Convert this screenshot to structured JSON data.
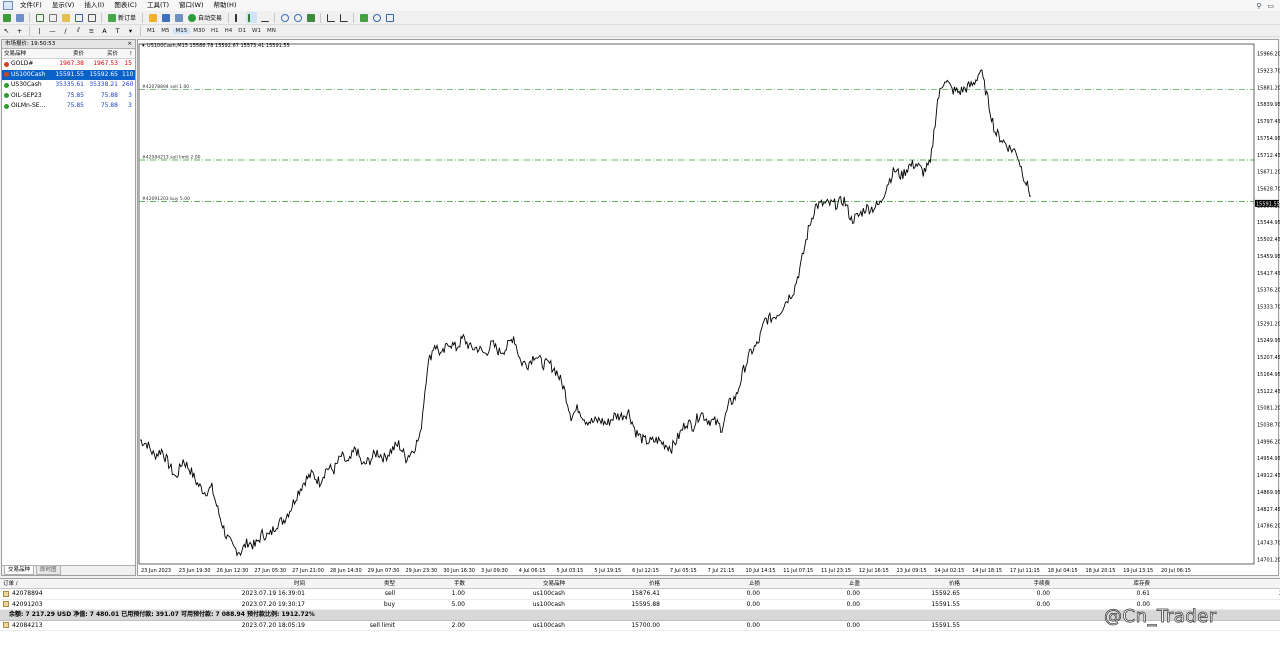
{
  "menu": [
    "文件(F)",
    "显示(V)",
    "插入(I)",
    "图表(C)",
    "工具(T)",
    "窗口(W)",
    "帮助(H)"
  ],
  "toolbar": {
    "new_order": "新订单",
    "auto_trading": "自动交易"
  },
  "timeframes": [
    "M1",
    "M5",
    "M15",
    "M30",
    "H1",
    "H4",
    "D1",
    "W1",
    "MN"
  ],
  "market": {
    "title": "市场报价: 19:50:53",
    "headers": [
      "交易品种",
      "卖价",
      "买价",
      "!"
    ],
    "rows": [
      {
        "symbol": "GOLD#",
        "bid": "1967.38",
        "ask": "1967.53",
        "spread": "15",
        "color": "#d84020",
        "pricecolor": "#e00000"
      },
      {
        "symbol": "US100Cash",
        "bid": "15591.55",
        "ask": "15592.65",
        "spread": "110",
        "color": "#d84020",
        "pricecolor": "#ffffff",
        "selected": true
      },
      {
        "symbol": "US30Cash",
        "bid": "35335.61",
        "ask": "35338.21",
        "spread": "260",
        "color": "#2aa02a",
        "pricecolor": "#1f3fd0"
      },
      {
        "symbol": "OIL-SEP23",
        "bid": "75.85",
        "ask": "75.88",
        "spread": "3",
        "color": "#2aa02a",
        "pricecolor": "#1f3fd0"
      },
      {
        "symbol": "OILMn-SE...",
        "bid": "75.85",
        "ask": "75.88",
        "spread": "3",
        "color": "#2aa02a",
        "pricecolor": "#1f3fd0"
      }
    ],
    "tabs": [
      "交易品种",
      "即时图"
    ]
  },
  "chart_data": {
    "type": "line",
    "title": "US100Cash,M15  15586.78 15592.67 15573.41 15591.55",
    "ylim": [
      14690,
      15990
    ],
    "y_ticks": [
      "15966.20",
      "15923.70",
      "15881.20",
      "15839.95",
      "15797.45",
      "15754.95",
      "15712.45",
      "15671.20",
      "15628.70",
      "15586.20",
      "15544.95",
      "15502.45",
      "15459.95",
      "15417.45",
      "15376.20",
      "15333.70",
      "15291.20",
      "15249.95",
      "15207.45",
      "15164.95",
      "15122.45",
      "15081.20",
      "15038.70",
      "14996.20",
      "14954.95",
      "14912.45",
      "14869.95",
      "14827.45",
      "14786.20",
      "14743.70",
      "14701.20",
      "14659.95"
    ],
    "x_ticks": [
      "23 Jun 2023",
      "23 Jun 19:30",
      "26 Jun 12:30",
      "27 Jun 05:30",
      "27 Jun 21:00",
      "28 Jun 14:30",
      "29 Jun 07:30",
      "29 Jun 23:30",
      "30 Jun 16:30",
      "3 Jul 09:30",
      "4 Jul 06:15",
      "5 Jul 03:15",
      "5 Jul 19:15",
      "6 Jul 12:15",
      "7 Jul 05:15",
      "7 Jul 21:15",
      "10 Jul 14:15",
      "11 Jul 07:15",
      "11 Jul 23:15",
      "12 Jul 16:15",
      "13 Jul 09:15",
      "14 Jul 02:15",
      "14 Jul 18:15",
      "17 Jul 11:15",
      "18 Jul 04:15",
      "18 Jul 20:15",
      "19 Jul 13:15",
      "20 Jul 06:15"
    ],
    "series": [
      {
        "values": [
          15000,
          14990,
          14960,
          14975,
          14940,
          14905,
          14950,
          14925,
          14890,
          14870,
          14880,
          14815,
          14760,
          14730,
          14720,
          14745,
          14735,
          14765,
          14760,
          14790,
          14800,
          14830,
          14870,
          14900,
          14915,
          14895,
          14930,
          14925,
          14960,
          14940,
          14980,
          14935,
          14950,
          14970,
          14955,
          14975,
          14990,
          14955,
          14975,
          15010,
          15185,
          15240,
          15210,
          15245,
          15230,
          15255,
          15230,
          15230,
          15215,
          15240,
          15220,
          15230,
          15260,
          15195,
          15190,
          15215,
          15190,
          15190,
          15170,
          15130,
          15060,
          15080,
          15050,
          15045,
          15050,
          15040,
          15060,
          15060,
          15070,
          15020,
          15000,
          14995,
          15000,
          14990,
          14980,
          15010,
          15045,
          15035,
          15070,
          15050,
          15045,
          15030,
          15090,
          15110,
          15175,
          15220,
          15240,
          15300,
          15305,
          15320,
          15350,
          15375,
          15440,
          15525,
          15585,
          15590,
          15590,
          15590,
          15600,
          15550,
          15560,
          15580,
          15580,
          15590,
          15640,
          15675,
          15660,
          15685,
          15690,
          15670,
          15690,
          15850,
          15905,
          15875,
          15870,
          15880,
          15890,
          15925,
          15850,
          15770,
          15750,
          15730,
          15720,
          15660,
          15610
        ]
      }
    ],
    "levels": [
      {
        "label": "#42078894 sell 1.00",
        "y": 15876.41
      },
      {
        "label": "#42084213 sell limit 2.00",
        "y": 15700.0
      },
      {
        "label": "#42091203 buy 5.00",
        "y": 15595.88
      }
    ],
    "current_price": "15591.55"
  },
  "terminal": {
    "headers": [
      "订单 /",
      "时间",
      "类型",
      "手数",
      "交易品种",
      "价格",
      "止损",
      "止盈",
      "价格",
      "手续费",
      "库存费",
      "获利",
      ""
    ],
    "rows": [
      [
        "42078894",
        "2023.07.19 16:39:01",
        "sell",
        "1.00",
        "us100cash",
        "15876.41",
        "0.00",
        "0.00",
        "15592.65",
        "0.00",
        "0.61",
        "283.76"
      ],
      [
        "42091203",
        "2023.07.20 19:30:17",
        "buy",
        "5.00",
        "us100cash",
        "15595.88",
        "0.00",
        "0.00",
        "15591.55",
        "0.00",
        "0.00",
        "-21.65"
      ]
    ],
    "balance": "余额: 7 217.29 USD  净值: 7 480.01  已用预付款: 391.07  可用预付款: 7 088.94  预付款比例: 1912.72%",
    "pending": [
      "42084213",
      "2023.07.20 18:05:19",
      "sell limit",
      "2.00",
      "us100cash",
      "15700.00",
      "0.00",
      "0.00",
      "15591.55",
      "",
      "",
      ""
    ]
  },
  "watermark": "@Cn_Trader"
}
